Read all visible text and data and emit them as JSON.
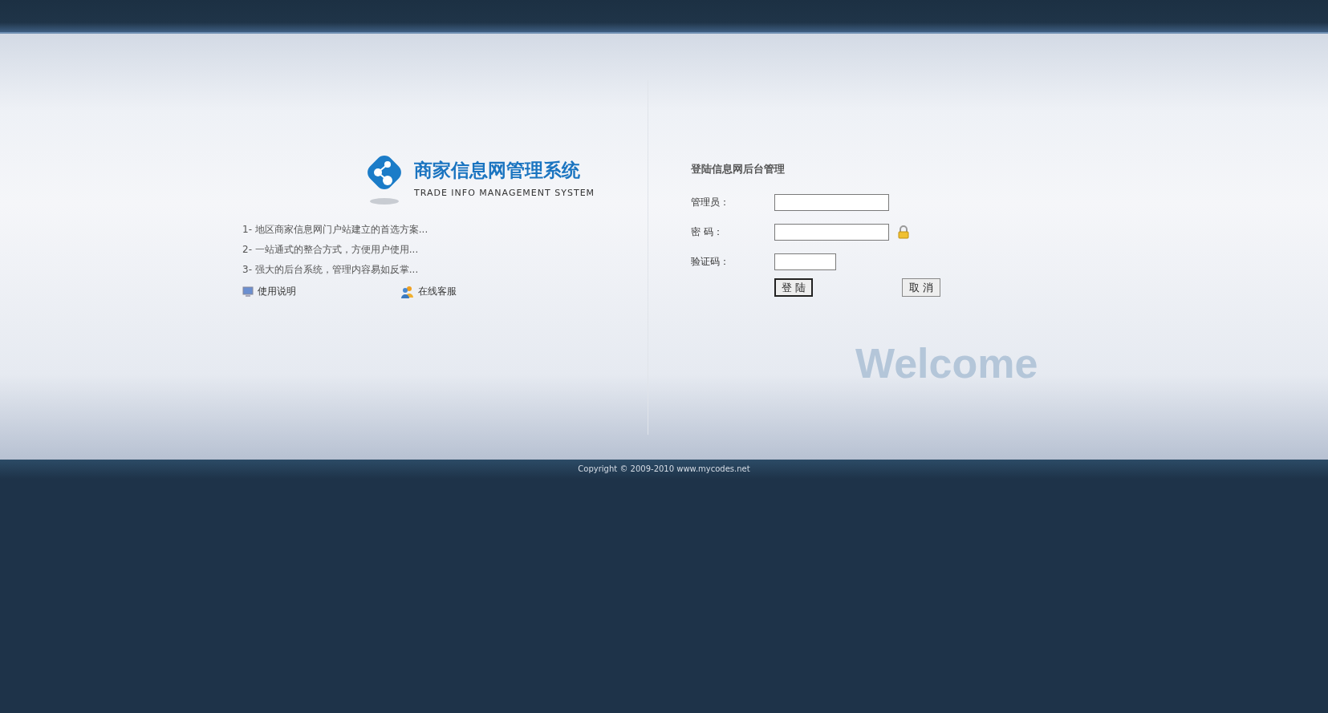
{
  "logo": {
    "title": "商家信息网管理系统",
    "subtitle": "TRADE INFO MANAGEMENT SYSTEM"
  },
  "features": [
    "1- 地区商家信息网门户站建立的首选方案...",
    "2- 一站通式的整合方式，方便用户使用...",
    "3- 强大的后台系统，管理内容易如反掌..."
  ],
  "links": [
    {
      "kind": "manual",
      "label": "使用说明"
    },
    {
      "kind": "support",
      "label": "在线客服"
    }
  ],
  "login": {
    "title": "登陆信息网后台管理",
    "fields": [
      {
        "kind": "user",
        "label": "管理员："
      },
      {
        "kind": "password",
        "label": "密 码："
      },
      {
        "kind": "captcha",
        "label": "验证码："
      }
    ],
    "buttons": [
      {
        "label": "登 陆",
        "focused": true
      },
      {
        "label": "取 消",
        "focused": false
      }
    ]
  },
  "welcome": "Welcome",
  "footer": {
    "copyright": "Copyright © 2009-2010 www.mycodes.net"
  }
}
